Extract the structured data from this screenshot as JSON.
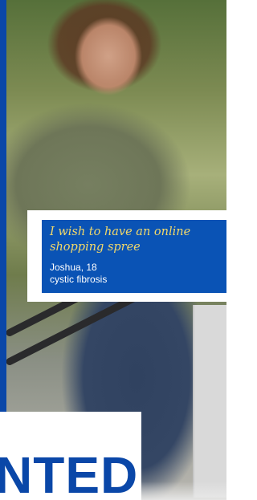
{
  "quote": {
    "text": "I wish to have an online shopping spree",
    "name": "Joshua, 18",
    "condition": "cystic fibrosis"
  },
  "headline": {
    "partial_word": "NTED"
  },
  "colors": {
    "brand_blue": "#0a47a8",
    "card_blue": "#0a53b5",
    "quote_gold": "#f1d86a"
  }
}
